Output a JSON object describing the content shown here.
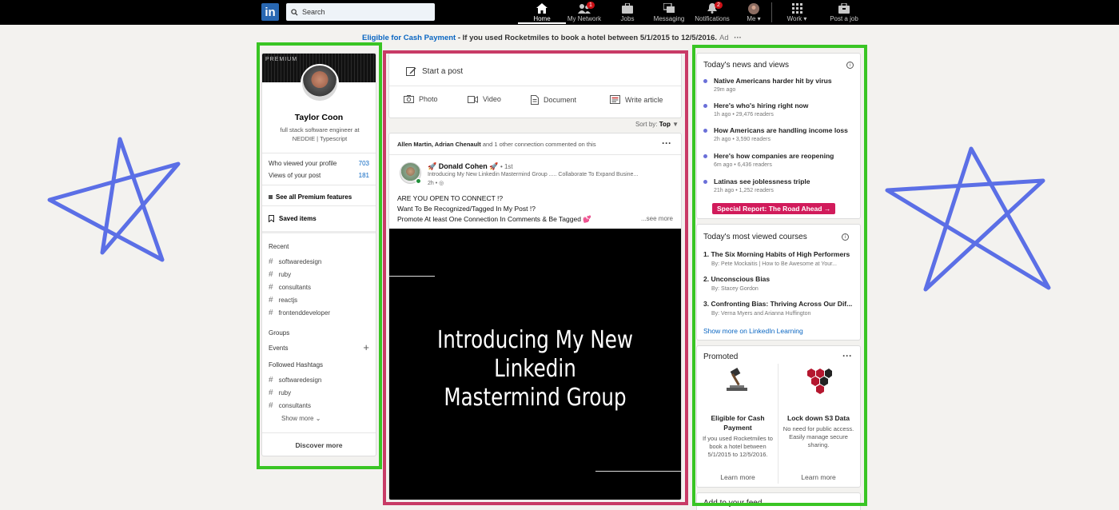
{
  "colors": {
    "nav_bg": "#000000",
    "brand": "#2867b2",
    "link": "#0a66c2",
    "highlight_green": "#39c524",
    "highlight_red": "#c83b66",
    "star": "#5b6fe6",
    "special_bg": "#d11b5b"
  },
  "nav": {
    "logo": "in",
    "search_placeholder": "Search",
    "items": [
      {
        "label": "Home",
        "icon": "home-icon",
        "active": true
      },
      {
        "label": "My Network",
        "icon": "network-icon",
        "badge": "1"
      },
      {
        "label": "Jobs",
        "icon": "briefcase-icon"
      },
      {
        "label": "Messaging",
        "icon": "messaging-icon"
      },
      {
        "label": "Notifications",
        "icon": "bell-icon",
        "badge": "2"
      },
      {
        "label": "Me",
        "icon": "avatar-icon"
      },
      {
        "label": "Work",
        "icon": "grid-icon"
      },
      {
        "label": "Post a job",
        "icon": "post-job-icon"
      }
    ]
  },
  "ad": {
    "link": "Eligible for Cash Payment",
    "text": " - If you used Rocketmiles to book a hotel between 5/1/2015 to 12/5/2016.",
    "tag": "Ad",
    "more": "···"
  },
  "profile": {
    "premium": "PREMIUM",
    "name": "Taylor Coon",
    "headline": "full stack software engineer at NEDDIE | Typescript",
    "stats": [
      {
        "label": "Who viewed your profile",
        "value": "703"
      },
      {
        "label": "Views of your post",
        "value": "181"
      }
    ],
    "premium_features": "See all Premium features",
    "saved": "Saved items",
    "recent_title": "Recent",
    "recent": [
      "softwaredesign",
      "ruby",
      "consultants",
      "reactjs",
      "frontenddeveloper"
    ],
    "groups": "Groups",
    "events": "Events",
    "followed_title": "Followed Hashtags",
    "followed": [
      "softwaredesign",
      "ruby",
      "consultants"
    ],
    "show_more": "Show more",
    "discover": "Discover more"
  },
  "composer": {
    "start_post": "Start a post",
    "actions": [
      "Photo",
      "Video",
      "Document",
      "Write article"
    ],
    "sort_label": "Sort by:",
    "sort_value": "Top"
  },
  "post": {
    "context_names": "Allen Martin, Adrian Chenault",
    "context_rest": " and 1 other connection commented on this",
    "author": "🚀 Donald Cohen 🚀",
    "degree": "• 1st",
    "subtitle": "Introducing My New Linkedin Mastermind Group ..... Collaborate To Expand Busine...",
    "time": "2h •",
    "lines": [
      "ARE YOU OPEN TO CONNECT !?",
      "Want To Be Recognized/Tagged In My Post !?",
      "Promote At least One Connection In Comments & Be Tagged 💕"
    ],
    "see_more": "...see more",
    "video_title": [
      "Introducing My New",
      "Linkedin",
      "Mastermind Group"
    ]
  },
  "news": {
    "title": "Today's news and views",
    "items": [
      {
        "headline": "Native Americans harder hit by virus",
        "meta": "29m ago"
      },
      {
        "headline": "Here's who's hiring right now",
        "meta": "1h ago • 29,476 readers"
      },
      {
        "headline": "How Americans are handling income loss",
        "meta": "2h ago • 3,590 readers"
      },
      {
        "headline": "Here's how companies are reopening",
        "meta": "6m ago • 6,436 readers"
      },
      {
        "headline": "Latinas see joblessness triple",
        "meta": "21h ago • 1,252 readers"
      }
    ],
    "special": "Special Report: The Road Ahead →"
  },
  "courses": {
    "title": "Today's most viewed courses",
    "items": [
      {
        "title": "1. The Six Morning Habits of High Performers",
        "by": "By: Pete Mockaitis | How to Be Awesome at Your..."
      },
      {
        "title": "2. Unconscious Bias",
        "by": "By: Stacey Gordon"
      },
      {
        "title": "3. Confronting Bias: Thriving Across Our Dif...",
        "by": "By: Verna Myers and Arianna Huffington"
      }
    ],
    "show_more": "Show more on LinkedIn Learning"
  },
  "promoted": {
    "title": "Promoted",
    "more": "···",
    "items": [
      {
        "title": "Eligible for Cash Payment",
        "desc": "If you used Rocketmiles to book a hotel between 5/1/2015 to 12/5/2016.",
        "cta": "Learn more",
        "icon": "gavel-icon"
      },
      {
        "title": "Lock down S3 Data",
        "desc": "No need for public access. Easily manage secure sharing.",
        "cta": "Learn more",
        "icon": "hexagon-logo-icon"
      }
    ]
  },
  "feed_footer": "Add to your feed"
}
